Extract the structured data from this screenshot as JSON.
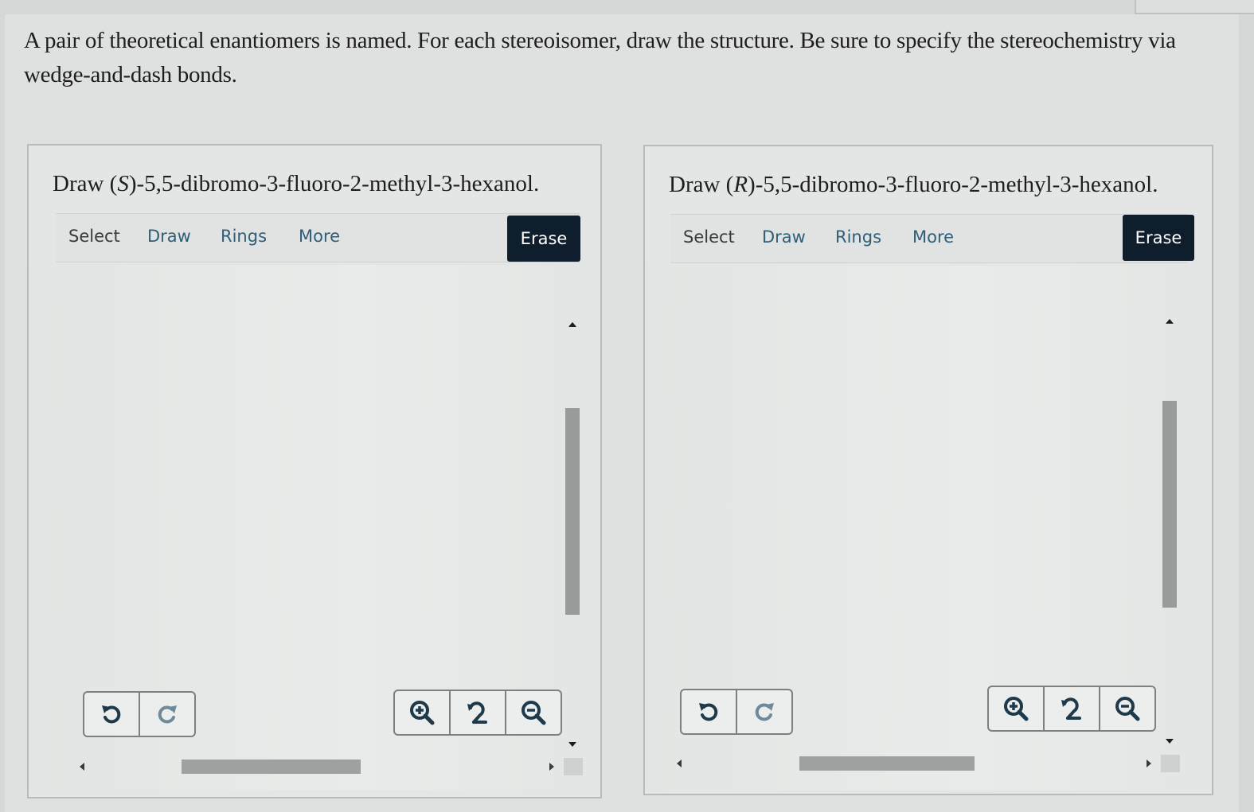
{
  "prompt": "A pair of theoretical enantiomers is named. For each stereoisomer, draw the structure. Be sure to specify the stereochemistry via wedge-and-dash bonds.",
  "panels": [
    {
      "title_prefix": "Draw (",
      "config": "S",
      "title_suffix": ")-5,5-dibromo-3-fluoro-2-methyl-3-hexanol.",
      "toolbar": {
        "select": "Select",
        "draw": "Draw",
        "rings": "Rings",
        "more": "More",
        "erase": "Erase"
      }
    },
    {
      "title_prefix": "Draw (",
      "config": "R",
      "title_suffix": ")-5,5-dibromo-3-fluoro-2-methyl-3-hexanol.",
      "toolbar": {
        "select": "Select",
        "draw": "Draw",
        "rings": "Rings",
        "more": "More",
        "erase": "Erase"
      }
    }
  ],
  "icons": {
    "undo": "undo-icon",
    "redo": "redo-icon",
    "zoom_in": "zoom-in-icon",
    "zoom_reset": "zoom-reset-icon",
    "zoom_out": "zoom-out-icon"
  },
  "colors": {
    "accent": "#2f5e79",
    "erase_bg": "#0f1e2c",
    "icon": "#1e3a4a"
  }
}
